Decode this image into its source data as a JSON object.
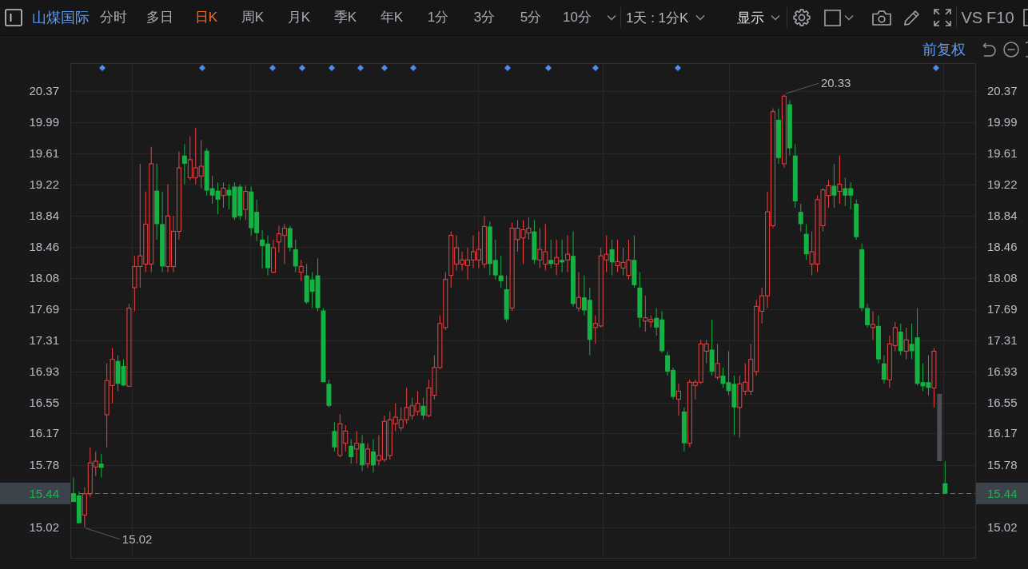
{
  "toolbar": {
    "stock_name": "山煤国际",
    "periods": [
      {
        "label": "分时",
        "selected": false
      },
      {
        "label": "多日",
        "selected": false
      },
      {
        "label": "日K",
        "selected": true
      },
      {
        "label": "周K",
        "selected": false
      },
      {
        "label": "月K",
        "selected": false
      },
      {
        "label": "季K",
        "selected": false
      },
      {
        "label": "年K",
        "selected": false
      },
      {
        "label": "1分",
        "selected": false
      },
      {
        "label": "3分",
        "selected": false
      },
      {
        "label": "5分",
        "selected": false
      },
      {
        "label": "10分",
        "selected": false
      }
    ],
    "interval_select": "1天 : 1分K",
    "display_menu": "显示",
    "links": [
      "VS",
      "F10"
    ]
  },
  "chart": {
    "adjustment": "前复权",
    "left_axis": {
      "current_price": "15.44"
    },
    "right_axis": {
      "labels": [
        "20.37",
        "19.99",
        "19.61",
        "19.22",
        "18.84",
        "18.46",
        "18.08",
        "17.69",
        "17.31",
        "16.93",
        "16.55",
        "16.17",
        "15.78",
        "15.02"
      ],
      "current_price": "15.44"
    },
    "high_label": "20.33",
    "low_label": "15.02",
    "chart_data": {
      "type": "candlestick",
      "grid": true,
      "ylim": [
        14.64,
        20.71
      ],
      "yticks": [
        {
          "value": 20.37,
          "label": "20.37"
        },
        {
          "value": 19.99,
          "label": "19.99"
        },
        {
          "value": 19.61,
          "label": "19.61"
        },
        {
          "value": 19.22,
          "label": "19.22"
        },
        {
          "value": 18.84,
          "label": "18.84"
        },
        {
          "value": 18.46,
          "label": "18.46"
        },
        {
          "value": 18.08,
          "label": "18.08"
        },
        {
          "value": 17.69,
          "label": "17.69"
        },
        {
          "value": 17.31,
          "label": "17.31"
        },
        {
          "value": 16.93,
          "label": "16.93"
        },
        {
          "value": 16.55,
          "label": "16.55"
        },
        {
          "value": 16.17,
          "label": "16.17"
        },
        {
          "value": 15.78,
          "label": "15.78"
        },
        {
          "value": 15.02,
          "label": "15.02"
        }
      ],
      "categories": [
        null,
        null,
        null,
        null,
        null,
        null,
        null,
        null,
        null,
        null,
        null,
        null,
        null,
        null,
        null,
        null,
        null,
        null,
        null,
        null,
        null,
        null,
        null,
        null,
        null,
        null,
        null,
        null,
        null,
        null,
        null,
        null,
        null,
        null,
        null,
        null,
        null,
        null,
        null,
        null,
        null,
        null,
        null,
        null,
        null,
        null,
        null,
        null,
        null,
        null,
        null,
        null,
        null,
        null,
        null,
        null,
        null,
        null,
        null,
        null,
        null,
        null,
        null,
        null,
        null,
        null,
        null,
        null,
        null,
        null,
        null,
        null,
        null,
        null,
        null,
        null,
        null,
        null,
        null,
        null,
        null,
        null,
        null,
        null,
        null,
        null,
        null,
        null,
        null,
        null,
        null,
        null,
        null,
        null,
        null,
        null,
        null,
        null,
        null,
        null,
        null,
        null,
        null,
        null,
        null,
        null,
        null,
        null,
        null,
        null,
        null,
        null,
        null,
        null,
        null,
        null,
        null,
        null,
        null,
        null,
        null,
        null,
        null,
        null,
        null,
        null,
        null,
        null,
        null,
        null,
        null,
        null,
        null,
        null,
        null,
        null,
        null,
        null,
        null,
        null,
        null,
        null,
        null,
        null,
        null,
        null,
        null,
        null,
        null,
        null,
        null,
        null,
        null,
        null,
        null,
        null,
        null,
        null,
        null,
        null,
        null,
        null,
        null
      ],
      "ohlc": [
        [
          15.43,
          15.63,
          15.33,
          15.33
        ],
        [
          15.41,
          15.46,
          15.07,
          15.07
        ],
        [
          15.17,
          15.51,
          15.02,
          15.43
        ],
        [
          15.43,
          16.0,
          15.39,
          15.81
        ],
        [
          15.76,
          15.95,
          15.65,
          15.83
        ],
        [
          15.8,
          15.92,
          15.63,
          15.75
        ],
        [
          16.4,
          17.03,
          16.0,
          16.82
        ],
        [
          16.76,
          17.22,
          16.54,
          17.08
        ],
        [
          17.06,
          17.13,
          16.69,
          16.78
        ],
        [
          17.0,
          17.08,
          16.75,
          16.76
        ],
        [
          16.75,
          17.76,
          16.75,
          17.71
        ],
        [
          17.96,
          18.35,
          17.67,
          18.22
        ],
        [
          18.22,
          19.48,
          17.96,
          18.35
        ],
        [
          18.25,
          19.14,
          18.15,
          18.74
        ],
        [
          18.25,
          19.69,
          18.15,
          19.48
        ],
        [
          19.15,
          19.48,
          18.55,
          18.74
        ],
        [
          18.74,
          19.14,
          18.15,
          18.22
        ],
        [
          18.22,
          19.23,
          18.15,
          18.84
        ],
        [
          18.22,
          18.84,
          18.15,
          18.65
        ],
        [
          18.65,
          19.63,
          18.55,
          19.43
        ],
        [
          19.58,
          19.72,
          19.23,
          19.48
        ],
        [
          19.31,
          19.82,
          19.28,
          19.53
        ],
        [
          19.31,
          19.92,
          19.23,
          19.43
        ],
        [
          19.33,
          19.77,
          19.18,
          19.45
        ],
        [
          19.64,
          19.67,
          19.09,
          19.15
        ],
        [
          19.18,
          19.33,
          18.99,
          19.09
        ],
        [
          19.15,
          19.25,
          18.86,
          19.04
        ],
        [
          19.09,
          19.25,
          18.94,
          19.18
        ],
        [
          19.16,
          19.23,
          18.92,
          19.09
        ],
        [
          19.2,
          19.25,
          18.79,
          18.82
        ],
        [
          19.2,
          19.23,
          18.79,
          18.84
        ],
        [
          18.92,
          19.21,
          18.79,
          19.14
        ],
        [
          19.14,
          19.2,
          18.6,
          18.69
        ],
        [
          18.89,
          19.04,
          18.53,
          18.63
        ],
        [
          18.55,
          18.67,
          18.19,
          18.47
        ],
        [
          18.5,
          18.6,
          18.11,
          18.2
        ],
        [
          18.15,
          18.55,
          18.14,
          18.45
        ],
        [
          18.52,
          18.72,
          18.39,
          18.62
        ],
        [
          18.6,
          18.74,
          18.25,
          18.69
        ],
        [
          18.69,
          18.72,
          18.4,
          18.45
        ],
        [
          18.43,
          18.55,
          18.15,
          18.22
        ],
        [
          18.15,
          18.3,
          18.04,
          18.22
        ],
        [
          18.11,
          18.25,
          17.76,
          17.78
        ],
        [
          18.06,
          18.15,
          17.71,
          17.91
        ],
        [
          18.11,
          18.32,
          17.67,
          17.71
        ],
        [
          17.68,
          17.71,
          16.8,
          16.8
        ],
        [
          16.78,
          16.83,
          16.49,
          16.51
        ],
        [
          16.2,
          16.31,
          15.95,
          16.0
        ],
        [
          15.9,
          16.41,
          15.88,
          16.29
        ],
        [
          16.05,
          16.27,
          15.95,
          16.2
        ],
        [
          16.02,
          16.1,
          15.8,
          15.88
        ],
        [
          15.98,
          16.2,
          15.8,
          16.05
        ],
        [
          16.05,
          16.15,
          15.71,
          15.78
        ],
        [
          15.8,
          16.05,
          15.75,
          15.98
        ],
        [
          15.95,
          16.1,
          15.69,
          15.78
        ],
        [
          15.84,
          16.15,
          15.78,
          15.9
        ],
        [
          15.85,
          16.39,
          15.82,
          16.32
        ],
        [
          15.9,
          16.44,
          15.85,
          16.34
        ],
        [
          16.29,
          16.54,
          16.2,
          16.37
        ],
        [
          16.24,
          16.49,
          16.2,
          16.34
        ],
        [
          16.34,
          16.73,
          16.29,
          16.49
        ],
        [
          16.39,
          16.61,
          16.34,
          16.51
        ],
        [
          16.44,
          16.69,
          16.39,
          16.54
        ],
        [
          16.51,
          16.61,
          16.34,
          16.39
        ],
        [
          16.39,
          16.83,
          16.37,
          16.73
        ],
        [
          16.64,
          17.13,
          16.59,
          16.98
        ],
        [
          16.98,
          17.62,
          16.96,
          17.52
        ],
        [
          17.47,
          18.15,
          17.44,
          18.06
        ],
        [
          18.11,
          18.65,
          17.96,
          18.6
        ],
        [
          18.25,
          18.6,
          18.17,
          18.45
        ],
        [
          18.25,
          18.4,
          18.17,
          18.3
        ],
        [
          18.23,
          18.45,
          18.06,
          18.3
        ],
        [
          18.3,
          18.6,
          18.2,
          18.4
        ],
        [
          18.3,
          18.65,
          18.2,
          18.43
        ],
        [
          18.25,
          18.84,
          18.2,
          18.71
        ],
        [
          18.71,
          18.77,
          18.11,
          18.25
        ],
        [
          18.3,
          18.55,
          18.06,
          18.11
        ],
        [
          18.11,
          18.35,
          17.96,
          18.04
        ],
        [
          17.94,
          18.11,
          17.54,
          17.57
        ],
        [
          17.71,
          18.76,
          17.67,
          18.69
        ],
        [
          18.55,
          18.79,
          18.4,
          18.69
        ],
        [
          18.57,
          18.79,
          18.25,
          18.67
        ],
        [
          18.63,
          18.82,
          18.55,
          18.69
        ],
        [
          18.65,
          18.79,
          18.25,
          18.3
        ],
        [
          18.3,
          18.69,
          18.2,
          18.43
        ],
        [
          18.25,
          18.74,
          18.17,
          18.4
        ],
        [
          18.3,
          18.55,
          18.2,
          18.25
        ],
        [
          18.25,
          18.55,
          18.11,
          18.33
        ],
        [
          18.3,
          18.55,
          18.15,
          18.27
        ],
        [
          18.3,
          18.6,
          18.15,
          18.37
        ],
        [
          18.35,
          18.65,
          17.73,
          17.76
        ],
        [
          17.71,
          18.15,
          17.67,
          17.84
        ],
        [
          17.84,
          18.11,
          17.62,
          17.68
        ],
        [
          17.81,
          17.96,
          17.13,
          17.32
        ],
        [
          17.47,
          17.62,
          17.27,
          17.52
        ],
        [
          17.49,
          18.45,
          17.47,
          18.35
        ],
        [
          18.3,
          18.6,
          18.15,
          18.37
        ],
        [
          18.43,
          18.55,
          18.11,
          18.27
        ],
        [
          18.23,
          18.55,
          18.15,
          18.28
        ],
        [
          18.2,
          18.45,
          18.11,
          18.27
        ],
        [
          18.11,
          18.55,
          18.06,
          18.3
        ],
        [
          18.3,
          18.6,
          17.96,
          17.99
        ],
        [
          17.96,
          18.15,
          17.47,
          17.59
        ],
        [
          17.55,
          17.86,
          17.42,
          17.59
        ],
        [
          17.54,
          17.62,
          17.47,
          17.57
        ],
        [
          17.59,
          17.71,
          17.37,
          17.47
        ],
        [
          17.57,
          17.67,
          17.16,
          17.18
        ],
        [
          17.13,
          17.18,
          16.88,
          16.93
        ],
        [
          16.95,
          16.98,
          16.59,
          16.62
        ],
        [
          16.59,
          16.78,
          16.39,
          16.69
        ],
        [
          16.44,
          16.49,
          15.95,
          16.05
        ],
        [
          16.05,
          16.83,
          16.0,
          16.8
        ],
        [
          16.76,
          16.83,
          16.59,
          16.8
        ],
        [
          16.8,
          17.32,
          16.78,
          17.27
        ],
        [
          17.18,
          17.32,
          17.03,
          17.27
        ],
        [
          17.2,
          17.57,
          16.88,
          16.93
        ],
        [
          16.86,
          17.27,
          16.83,
          17.03
        ],
        [
          16.88,
          16.98,
          16.73,
          16.78
        ],
        [
          16.8,
          17.18,
          16.64,
          16.69
        ],
        [
          16.78,
          16.88,
          16.15,
          16.49
        ],
        [
          16.49,
          16.88,
          16.12,
          16.78
        ],
        [
          16.69,
          17.03,
          16.64,
          16.8
        ],
        [
          16.69,
          17.27,
          16.64,
          17.08
        ],
        [
          16.93,
          17.81,
          16.88,
          17.73
        ],
        [
          17.67,
          17.96,
          17.52,
          17.86
        ],
        [
          17.86,
          19.14,
          17.71,
          18.89
        ],
        [
          18.72,
          20.16,
          18.69,
          20.12
        ],
        [
          20.02,
          20.16,
          19.48,
          19.55
        ],
        [
          19.48,
          20.33,
          19.43,
          20.31
        ],
        [
          20.21,
          20.26,
          19.58,
          19.67
        ],
        [
          19.58,
          19.72,
          18.94,
          19.02
        ],
        [
          18.89,
          18.99,
          18.65,
          18.74
        ],
        [
          18.62,
          18.74,
          18.3,
          18.37
        ],
        [
          18.25,
          18.65,
          18.11,
          18.4
        ],
        [
          18.25,
          19.09,
          18.15,
          19.04
        ],
        [
          18.72,
          19.18,
          18.65,
          19.16
        ],
        [
          19.09,
          19.28,
          18.94,
          19.21
        ],
        [
          19.21,
          19.48,
          18.94,
          19.09
        ],
        [
          19.14,
          19.58,
          18.99,
          19.23
        ],
        [
          19.18,
          19.31,
          18.96,
          19.09
        ],
        [
          19.18,
          19.25,
          18.92,
          19.09
        ],
        [
          18.99,
          19.04,
          18.55,
          18.58
        ],
        [
          18.43,
          18.5,
          17.67,
          17.71
        ],
        [
          17.71,
          17.76,
          17.47,
          17.5
        ],
        [
          17.47,
          17.67,
          17.32,
          17.51
        ],
        [
          17.49,
          17.62,
          17.03,
          17.08
        ],
        [
          17.03,
          17.13,
          16.78,
          16.83
        ],
        [
          16.83,
          17.37,
          16.73,
          17.27
        ],
        [
          17.25,
          17.54,
          17.18,
          17.47
        ],
        [
          17.42,
          17.52,
          17.13,
          17.18
        ],
        [
          17.18,
          17.47,
          17.08,
          17.32
        ],
        [
          17.27,
          17.52,
          17.08,
          17.18
        ],
        [
          17.35,
          17.71,
          16.76,
          16.78
        ],
        [
          16.8,
          17.03,
          16.69,
          16.75
        ],
        [
          16.8,
          17.13,
          16.64,
          16.73
        ],
        [
          16.73,
          17.22,
          16.49,
          17.18
        ],
        null,
        [
          15.56,
          15.83,
          15.44,
          15.44
        ],
        null,
        null,
        null,
        null,
        null
      ]
    }
  }
}
